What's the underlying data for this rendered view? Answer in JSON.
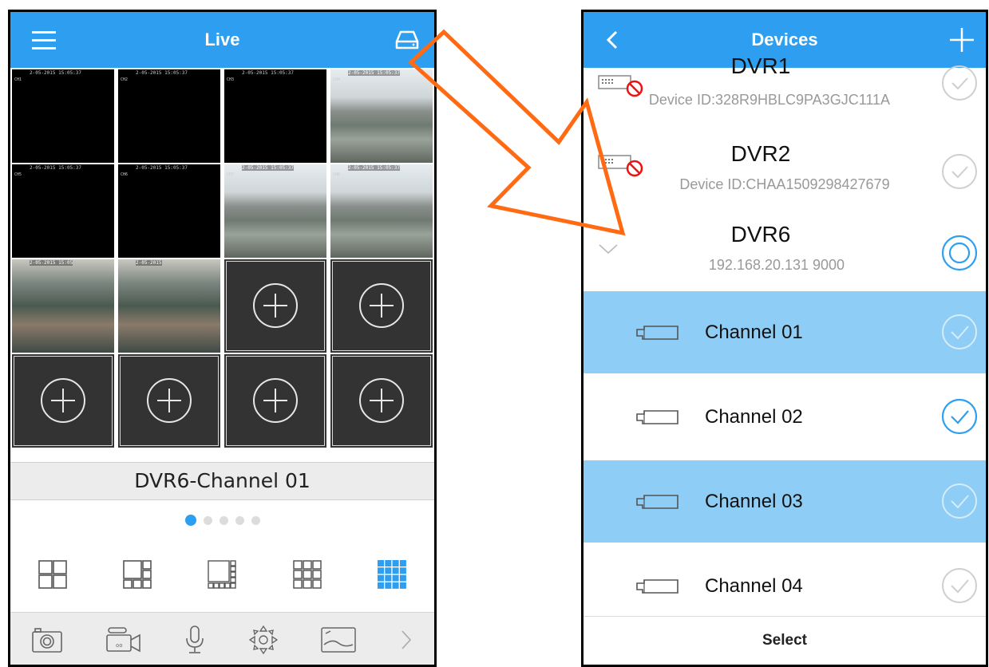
{
  "live": {
    "title": "Live",
    "tiles": [
      {
        "kind": "black",
        "ts": "2-05-2015 15:05:37",
        "ch": "CH1"
      },
      {
        "kind": "black",
        "ts": "2-05-2015 15:05:37",
        "ch": "CH2"
      },
      {
        "kind": "black",
        "ts": "2-05-2015 15:05:37",
        "ch": "CH3"
      },
      {
        "kind": "cam",
        "ts": "2-05-2015 15:05:37",
        "ch": "CH4"
      },
      {
        "kind": "black",
        "ts": "2-05-2015 15:05:37",
        "ch": "CH5"
      },
      {
        "kind": "black",
        "ts": "2-05-2015 15:05:37",
        "ch": "CH6"
      },
      {
        "kind": "cam",
        "ts": "2-05-2015 15:05:37",
        "ch": "CH7"
      },
      {
        "kind": "cam",
        "ts": "2-05-2015 15:05:37",
        "ch": "CH8"
      },
      {
        "kind": "cam",
        "ts": "2-05-2015 15:05",
        "ch": ""
      },
      {
        "kind": "cam",
        "ts": "2-05-2015",
        "ch": ""
      },
      {
        "kind": "empty"
      },
      {
        "kind": "empty"
      },
      {
        "kind": "empty"
      },
      {
        "kind": "empty"
      },
      {
        "kind": "empty"
      },
      {
        "kind": "empty"
      }
    ],
    "selected_channel": "DVR6-Channel 01",
    "pager": {
      "count": 5,
      "active": 0
    },
    "layout_icons": [
      "layout-4-icon",
      "layout-6-icon",
      "layout-8-icon",
      "layout-9-icon",
      "layout-16-icon"
    ],
    "toolbar_icons": [
      "camera-icon",
      "video-record-icon",
      "microphone-icon",
      "ptz-icon",
      "picture-icon",
      "chevron-right-icon"
    ]
  },
  "devices": {
    "title": "Devices",
    "items": [
      {
        "name": "DVR1",
        "sub": "Device ID:328R9HBLC9PA3GJC111A",
        "offline": true
      },
      {
        "name": "DVR2",
        "sub": "Device ID:CHAA1509298427679",
        "offline": true
      },
      {
        "name": "DVR6",
        "sub": "192.168.20.131   9000",
        "expanded": true
      }
    ],
    "channels": [
      {
        "label": "Channel 01",
        "highlight": true,
        "checked": false
      },
      {
        "label": "Channel 02",
        "highlight": false,
        "checked": true
      },
      {
        "label": "Channel 03",
        "highlight": true,
        "checked": false
      },
      {
        "label": "Channel 04",
        "highlight": false,
        "checked": false
      }
    ],
    "select_label": "Select"
  },
  "colors": {
    "accent": "#2e9ff0",
    "highlight": "#8dcdf6",
    "arrow": "#ff6a13"
  }
}
